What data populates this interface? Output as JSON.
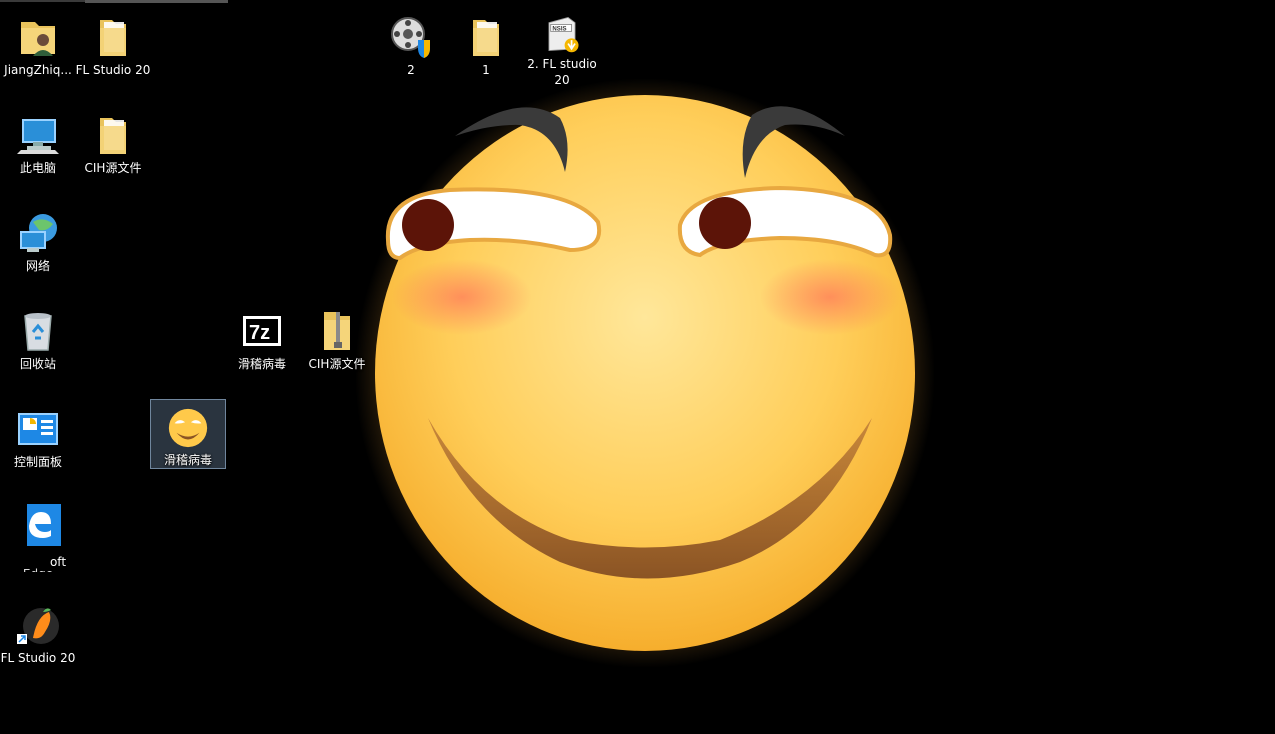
{
  "desktop": {
    "icons": [
      {
        "id": "user-folder",
        "label": "JiangZhiq..."
      },
      {
        "id": "fl-studio-folder",
        "label": "FL Studio 20"
      },
      {
        "id": "this-pc",
        "label": "此电脑"
      },
      {
        "id": "cih-folder",
        "label": "CIH源文件"
      },
      {
        "id": "network",
        "label": "网络"
      },
      {
        "id": "recycle-bin",
        "label": "回收站"
      },
      {
        "id": "control-panel",
        "label": "控制面板"
      },
      {
        "id": "edge",
        "label": "oft"
      },
      {
        "id": "edge-sub",
        "label": "Edge"
      },
      {
        "id": "fl-studio-shortcut",
        "label": "FL Studio 20"
      },
      {
        "id": "7z-archive",
        "label": "滑稽病毒"
      },
      {
        "id": "cih-zip",
        "label": "CIH源文件"
      },
      {
        "id": "funny-virus",
        "label": "滑稽病毒"
      },
      {
        "id": "installer-2",
        "label": "2"
      },
      {
        "id": "folder-1",
        "label": "1"
      },
      {
        "id": "nsis-installer",
        "label": "2. FL studio 20"
      }
    ]
  },
  "colors": {
    "background": "#000000",
    "face": "#FFC94A",
    "folder": "#F5D57A",
    "edge_blue": "#1E88E5"
  }
}
